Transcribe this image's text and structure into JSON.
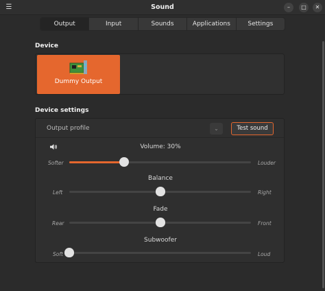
{
  "window": {
    "title": "Sound"
  },
  "tabs": [
    {
      "label": "Output",
      "active": true
    },
    {
      "label": "Input",
      "active": false
    },
    {
      "label": "Sounds",
      "active": false
    },
    {
      "label": "Applications",
      "active": false
    },
    {
      "label": "Settings",
      "active": false
    }
  ],
  "device_section": {
    "title": "Device",
    "selected_device": "Dummy Output"
  },
  "settings_section": {
    "title": "Device settings",
    "output_profile_label": "Output profile",
    "test_sound_label": "Test sound",
    "sliders": [
      {
        "title": "Volume: 30%",
        "min_label": "Softer",
        "max_label": "Louder",
        "value": 0.3
      },
      {
        "title": "Balance",
        "min_label": "Left",
        "max_label": "Right",
        "value": 0.5
      },
      {
        "title": "Fade",
        "min_label": "Rear",
        "max_label": "Front",
        "value": 0.5
      },
      {
        "title": "Subwoofer",
        "min_label": "Soft",
        "max_label": "Loud",
        "value": 0.0
      }
    ]
  },
  "colors": {
    "accent": "#e5672e",
    "background": "#2b2b2b"
  }
}
